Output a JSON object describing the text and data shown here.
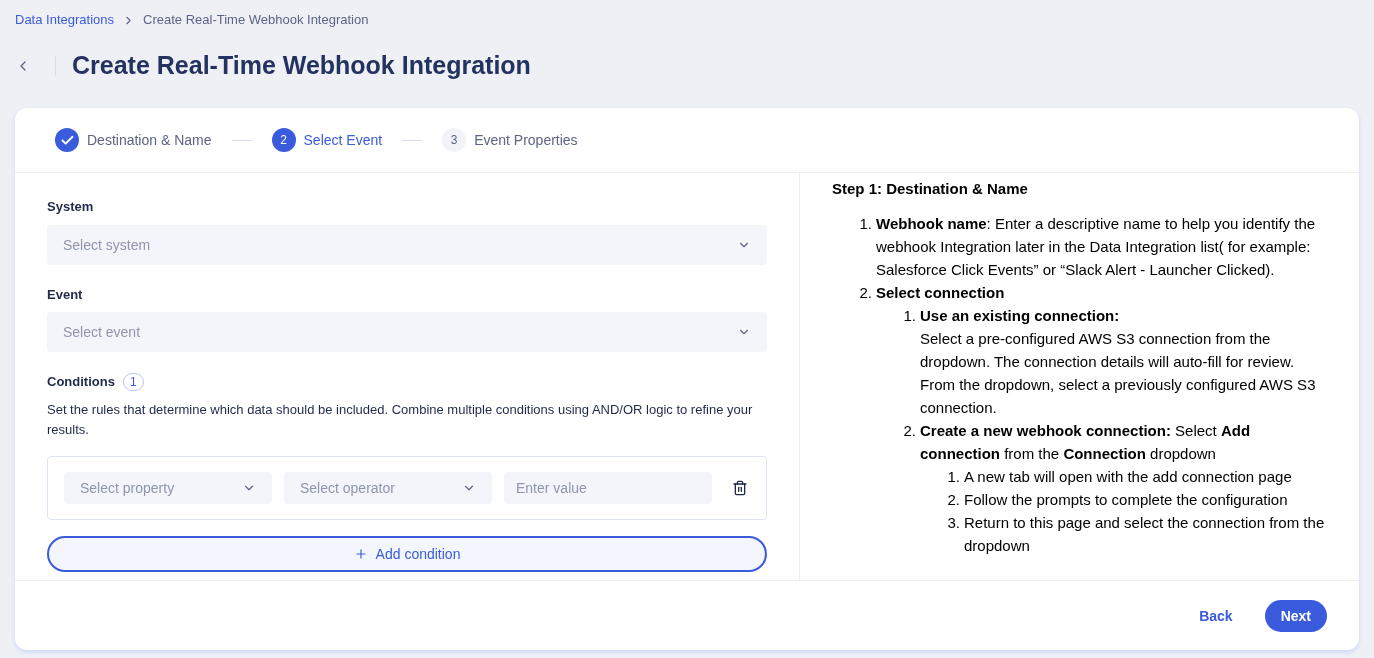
{
  "breadcrumb": [
    {
      "label": "Data Integrations",
      "link": true
    },
    {
      "label": "Create Real-Time Webhook Integration",
      "link": false
    }
  ],
  "page_title": "Create Real-Time Webhook Integration",
  "steps": [
    {
      "label": "Destination & Name",
      "completed": true,
      "selected": false
    },
    {
      "label": "Select Event",
      "number": "2",
      "completed": false,
      "selected": true
    },
    {
      "label": "Event Properties",
      "number": "3",
      "completed": false,
      "selected": false
    }
  ],
  "form": {
    "fields": [
      {
        "label": "System",
        "placeholder": "Select system"
      },
      {
        "label": "Event",
        "placeholder": "Select event"
      }
    ],
    "conditions": {
      "label": "Conditions",
      "count": "1",
      "description": "Set the rules that determine which data should be included. Combine multiple conditions using AND/OR logic to refine your results.",
      "rows": [
        {
          "property_placeholder": "Select property",
          "operator_placeholder": "Select operator",
          "value_placeholder": "Enter value"
        }
      ],
      "add_button": "Add condition"
    }
  },
  "help": {
    "heading": "Step 1: Destination & Name",
    "items": [
      {
        "number": "1.",
        "text": "**Webhook name**: Enter a descriptive name to help you identify the webhook Integration later in the Data Integration list( for example: Salesforce Click Events” or “Slack Alert - Launcher Clicked)."
      },
      {
        "number": "2.",
        "text": "**Select connection**",
        "children": [
          {
            "number": "1.",
            "text": "**Use an existing connection:**",
            "detail": "Select a pre-configured AWS S3 connection from the dropdown. The connection details will auto-fill for review. From the dropdown, select a previously configured AWS S3 connection."
          },
          {
            "number": "2.",
            "text": "**Create a new webhook connection:** Select **Add connection** from the **Connection** dropdown",
            "children": [
              {
                "number": "1.",
                "text": "A new tab will open with the add connection page"
              },
              {
                "number": "2.",
                "text": "Follow the prompts to complete the configuration"
              },
              {
                "number": "3.",
                "text": "Return to this page and select the connection from the dropdown"
              }
            ]
          }
        ]
      }
    ]
  },
  "footer": {
    "back": "Back",
    "next": "Next"
  }
}
